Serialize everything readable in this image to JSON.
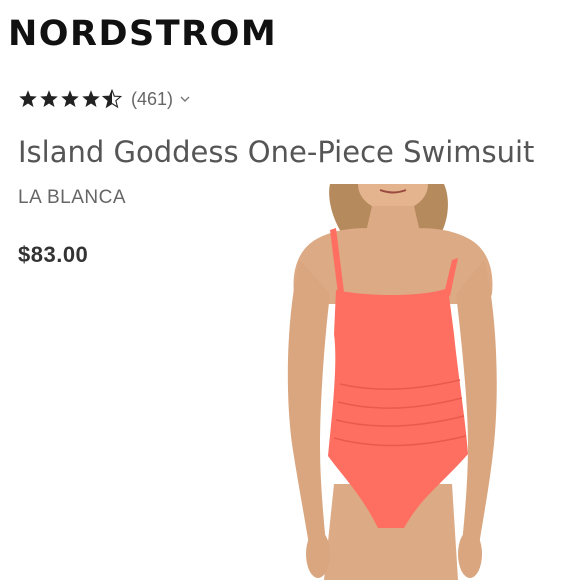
{
  "header": {
    "logo_text": "NORDSTROM"
  },
  "product": {
    "rating_stars": 4.5,
    "review_count": "(461)",
    "title": "Island Goddess One-Piece Swimsuit",
    "brand": "LA BLANCA",
    "price": "$83.00"
  },
  "icons": {
    "star": "star-icon",
    "chevron": "chevron-down-icon"
  },
  "colors": {
    "swimsuit": "#ff6f61",
    "stars": "#222222"
  }
}
